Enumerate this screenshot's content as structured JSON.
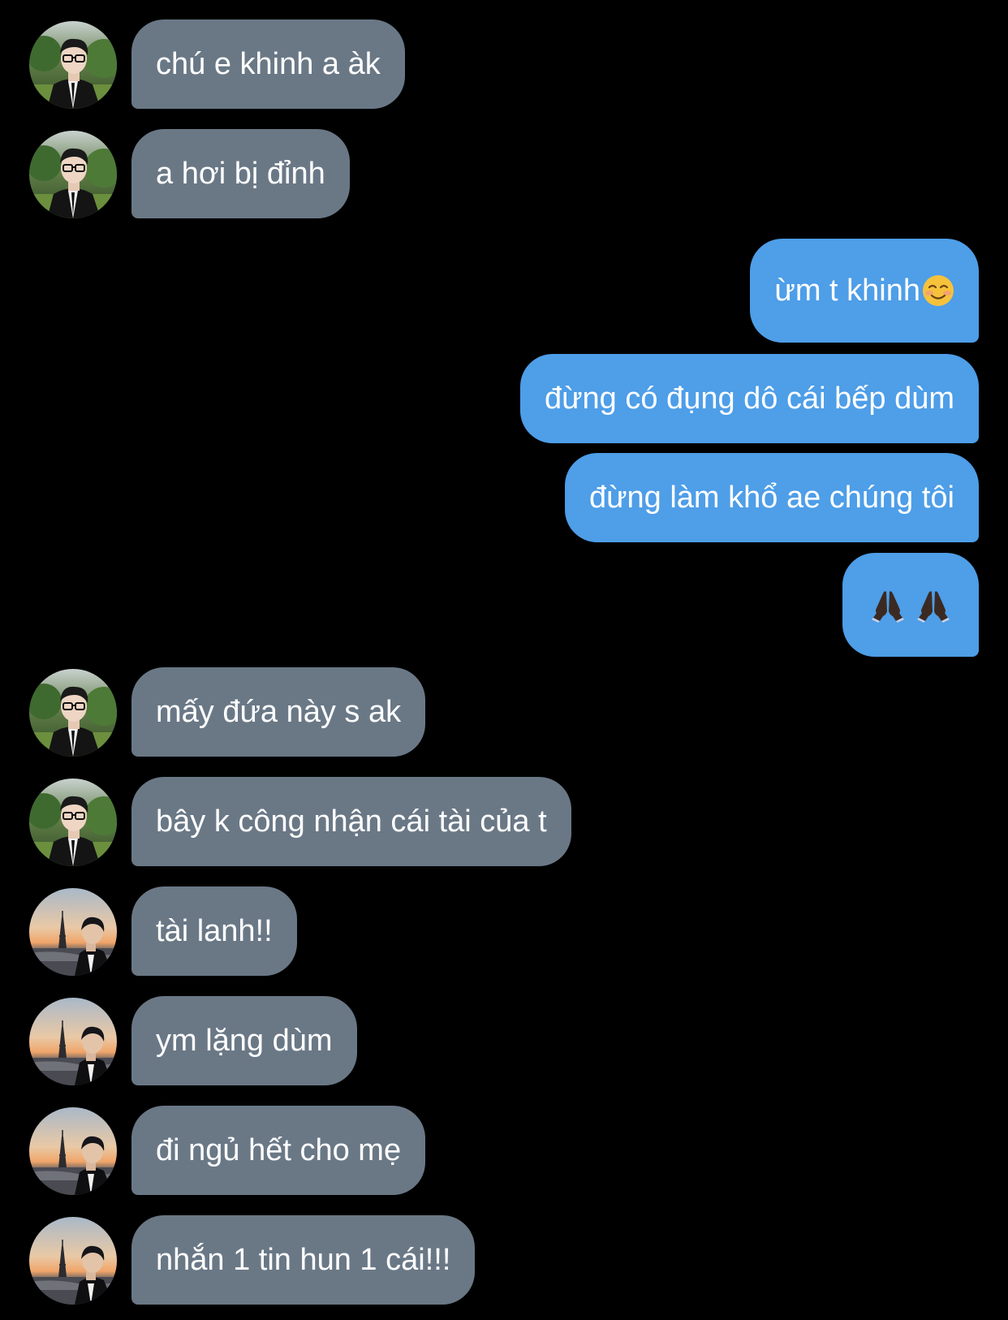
{
  "messages": [
    {
      "side": "in",
      "avatar": "avatar-glasses-man",
      "text": "chú e khinh a àk"
    },
    {
      "side": "in",
      "avatar": "avatar-glasses-man",
      "text": "a hơi bị đỉnh"
    },
    {
      "side": "out",
      "text": "ừm t khinh",
      "emoji": "smiling-face-icon"
    },
    {
      "side": "out",
      "text": "đừng có đụng dô cái bếp dùm"
    },
    {
      "side": "out",
      "text": "đừng làm khổ ae chúng tôi"
    },
    {
      "side": "out",
      "text": "",
      "emoji": "folded-hands-icon"
    },
    {
      "side": "in",
      "avatar": "avatar-glasses-man",
      "text": "mấy đứa này s ak"
    },
    {
      "side": "in",
      "avatar": "avatar-glasses-man",
      "text": "bây k công nhận cái tài của t"
    },
    {
      "side": "in",
      "avatar": "avatar-eiffel-man",
      "text": "tài lanh!!"
    },
    {
      "side": "in",
      "avatar": "avatar-eiffel-man",
      "text": "ym lặng dùm"
    },
    {
      "side": "in",
      "avatar": "avatar-eiffel-man",
      "text": "đi ngủ hết cho mẹ"
    },
    {
      "side": "in",
      "avatar": "avatar-eiffel-man",
      "text": "nhắn 1 tin hun 1 cái!!!"
    }
  ],
  "colors": {
    "background": "#000000",
    "incoming_bubble": "#6a7886",
    "outgoing_bubble": "#4e9ee8",
    "text": "#ffffff"
  }
}
